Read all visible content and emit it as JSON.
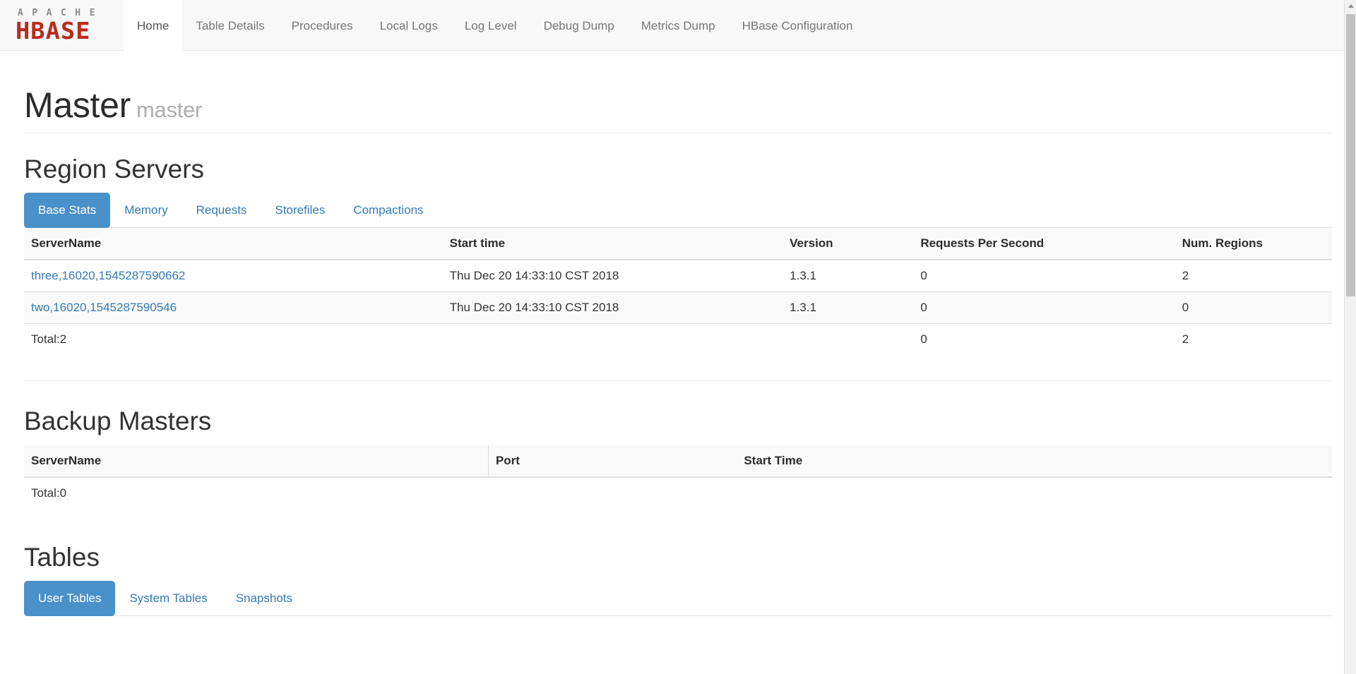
{
  "brand": {
    "apache": "APACHE",
    "hbase": "HBASE"
  },
  "nav": {
    "items": [
      {
        "label": "Home",
        "active": true
      },
      {
        "label": "Table Details",
        "active": false
      },
      {
        "label": "Procedures",
        "active": false
      },
      {
        "label": "Local Logs",
        "active": false
      },
      {
        "label": "Log Level",
        "active": false
      },
      {
        "label": "Debug Dump",
        "active": false
      },
      {
        "label": "Metrics Dump",
        "active": false
      },
      {
        "label": "HBase Configuration",
        "active": false
      }
    ]
  },
  "header": {
    "title": "Master",
    "subtitle": "master"
  },
  "region_servers": {
    "heading": "Region Servers",
    "tabs": [
      {
        "label": "Base Stats",
        "active": true
      },
      {
        "label": "Memory",
        "active": false
      },
      {
        "label": "Requests",
        "active": false
      },
      {
        "label": "Storefiles",
        "active": false
      },
      {
        "label": "Compactions",
        "active": false
      }
    ],
    "columns": [
      "ServerName",
      "Start time",
      "Version",
      "Requests Per Second",
      "Num. Regions"
    ],
    "rows": [
      {
        "server_name": "three,16020,1545287590662",
        "start_time": "Thu Dec 20 14:33:10 CST 2018",
        "version": "1.3.1",
        "requests_per_second": "0",
        "num_regions": "2"
      },
      {
        "server_name": "two,16020,1545287590546",
        "start_time": "Thu Dec 20 14:33:10 CST 2018",
        "version": "1.3.1",
        "requests_per_second": "0",
        "num_regions": "0"
      }
    ],
    "total": {
      "label": "Total:2",
      "start_time": "",
      "version": "",
      "requests_per_second": "0",
      "num_regions": "2"
    }
  },
  "backup_masters": {
    "heading": "Backup Masters",
    "columns": [
      "ServerName",
      "Port",
      "Start Time"
    ],
    "rows": [],
    "total": {
      "label": "Total:0",
      "port": "",
      "start_time": ""
    }
  },
  "tables": {
    "heading": "Tables",
    "tabs": [
      {
        "label": "User Tables",
        "active": true
      },
      {
        "label": "System Tables",
        "active": false
      },
      {
        "label": "Snapshots",
        "active": false
      }
    ]
  },
  "colors": {
    "brand_red": "#ba2b1f",
    "brand_grey": "#8c8c8c",
    "link_blue": "#337ab7",
    "active_tab_blue": "#4a90c9",
    "navbar_bg": "#f8f8f8"
  }
}
